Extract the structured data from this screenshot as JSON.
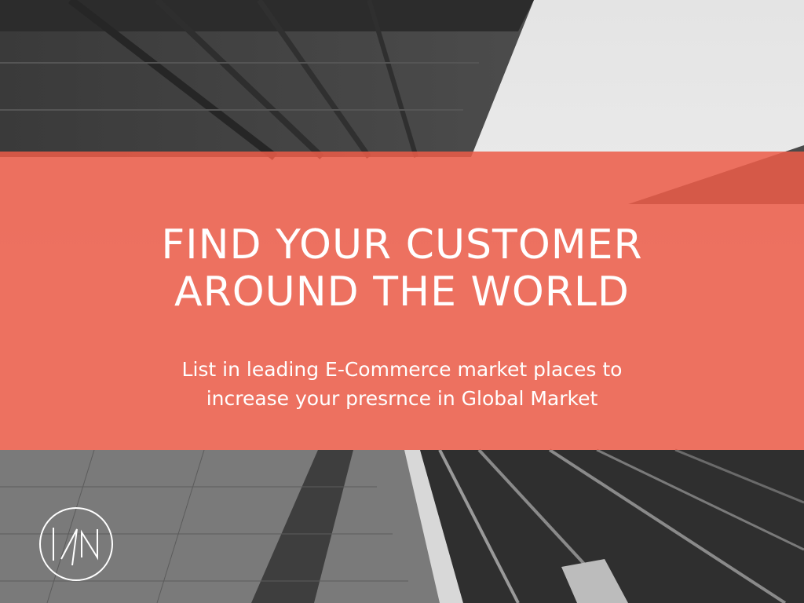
{
  "hero": {
    "headline_line1": "FIND YOUR CUSTOMER",
    "headline_line2": "AROUND THE WORLD",
    "subtitle_line1": "List in leading E-Commerce market places to",
    "subtitle_line2": "increase your presrnce in Global Market"
  },
  "logo": {
    "icon": "kn-monogram-circle-icon",
    "text": "KN"
  },
  "colors": {
    "banner": "#EC5C48",
    "text": "#FFFFFF"
  }
}
